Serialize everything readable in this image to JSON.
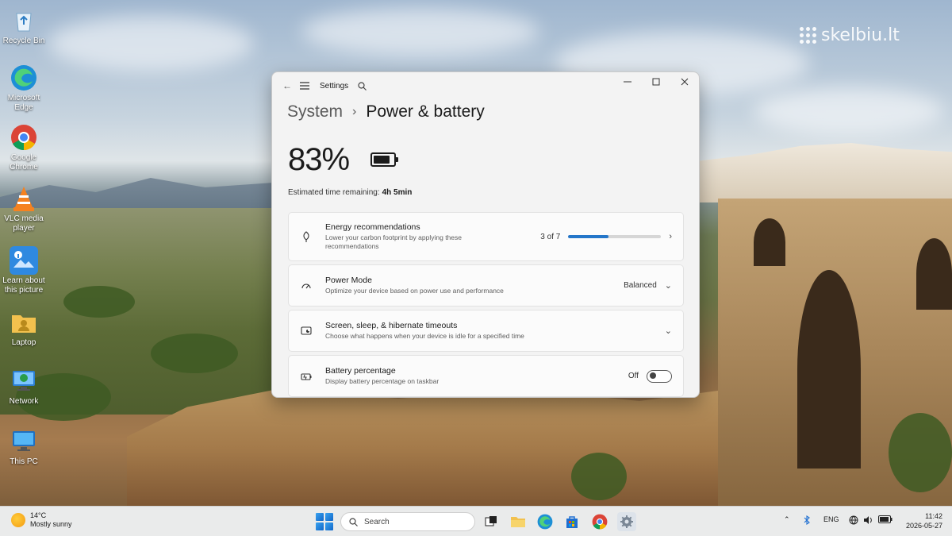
{
  "desktop": {
    "watermark": "skelbiu.lt",
    "icons": [
      {
        "label": "Recycle Bin",
        "icon": "recycle-bin-icon"
      },
      {
        "label": "Microsoft Edge",
        "icon": "edge-icon"
      },
      {
        "label": "Google Chrome",
        "icon": "chrome-icon"
      },
      {
        "label": "VLC media player",
        "icon": "vlc-icon"
      },
      {
        "label": "Learn about this picture",
        "icon": "learn-picture-icon"
      },
      {
        "label": "Laptop",
        "icon": "user-folder-icon"
      },
      {
        "label": "Network",
        "icon": "network-icon"
      },
      {
        "label": "This PC",
        "icon": "this-pc-icon"
      }
    ]
  },
  "window": {
    "title": "Settings",
    "breadcrumb_parent": "System",
    "breadcrumb_current": "Power & battery",
    "battery_percent": "83%",
    "battery_level": 0.83,
    "estimated_label": "Estimated time remaining:",
    "estimated_value": "4h 5min",
    "cards": {
      "energy": {
        "title": "Energy recommendations",
        "subtitle": "Lower your carbon footprint by applying these recommendations",
        "progress_text": "3 of 7",
        "progress_fraction": 0.43,
        "icon": "leaf-icon"
      },
      "power_mode": {
        "title": "Power Mode",
        "subtitle": "Optimize your device based on power use and performance",
        "value": "Balanced",
        "icon": "gauge-icon"
      },
      "screen_sleep": {
        "title": "Screen, sleep, & hibernate timeouts",
        "subtitle": "Choose what happens when your device is idle for a specified time",
        "icon": "screen-sleep-icon"
      },
      "battery_pct": {
        "title": "Battery percentage",
        "subtitle": "Display battery percentage on taskbar",
        "toggle_label": "Off",
        "toggle_on": false,
        "icon": "battery-saver-icon"
      }
    }
  },
  "taskbar": {
    "weather_temp": "14°C",
    "weather_desc": "Mostly sunny",
    "search_placeholder": "Search",
    "language": "ENG",
    "time": "11:42",
    "date": "2026-05-27",
    "colors": {
      "accent": "#2476c9"
    }
  }
}
